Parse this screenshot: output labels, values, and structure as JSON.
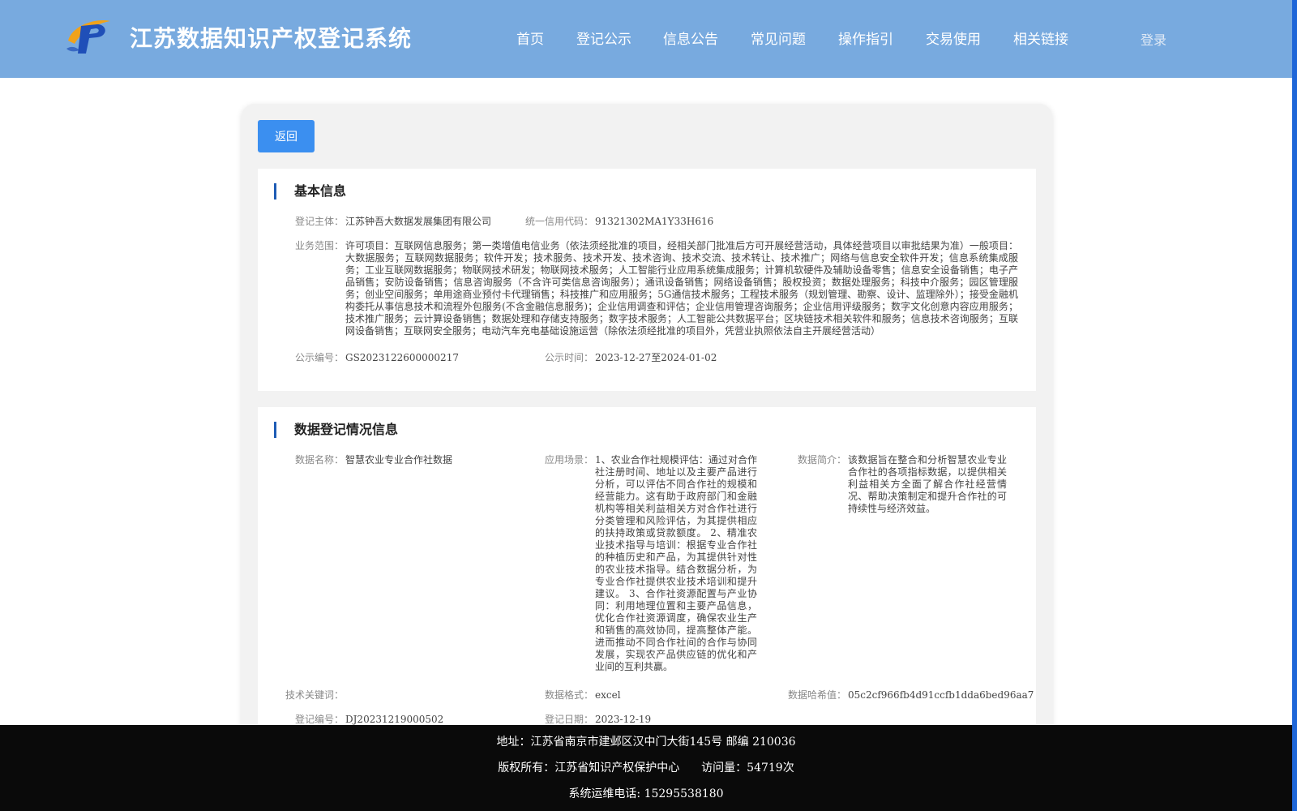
{
  "header": {
    "title": "江苏数据知识产权登记系统",
    "nav": [
      "首页",
      "登记公示",
      "信息公告",
      "常见问题",
      "操作指引",
      "交易使用",
      "相关链接"
    ],
    "login": "登录",
    "logo_colors": [
      "#f0a21a",
      "#1f4fb8"
    ]
  },
  "back_button": "返回",
  "basic": {
    "title": "基本信息",
    "subject_label": "登记主体：",
    "subject": "江苏钟吾大数据发展集团有限公司",
    "credit_label": "统一信用代码：",
    "credit_code": "91321302MA1Y33H616",
    "scope_label": "业务范围：",
    "scope": "许可项目：互联网信息服务；第一类增值电信业务（依法须经批准的项目，经相关部门批准后方可开展经营活动，具体经营项目以审批结果为准）一般项目：大数据服务；互联网数据服务；软件开发；技术服务、技术开发、技术咨询、技术交流、技术转让、技术推广；网络与信息安全软件开发；信息系统集成服务；工业互联网数据服务；物联网技术研发；物联网技术服务；人工智能行业应用系统集成服务；计算机软硬件及辅助设备零售；信息安全设备销售；电子产品销售；安防设备销售；信息咨询服务（不含许可类信息咨询服务）；通讯设备销售；网络设备销售；股权投资；数据处理服务；科技中介服务；园区管理服务；创业空间服务；单用途商业预付卡代理销售；科技推广和应用服务；5G通信技术服务；工程技术服务（规划管理、勘察、设计、监理除外）；接受金融机构委托从事信息技术和流程外包服务(不含金融信息服务)；企业信用调查和评估；企业信用管理咨询服务；企业信用评级服务；数字文化创意内容应用服务；技术推广服务；云计算设备销售；数据处理和存储支持服务；数字技术服务；人工智能公共数据平台；区块链技术相关软件和服务；信息技术咨询服务；互联网设备销售；互联网安全服务；电动汽车充电基础设施运营（除依法须经批准的项目外，凭营业执照依法自主开展经营活动）",
    "pub_no_label": "公示编号：",
    "pub_no": "GS2023122600000217",
    "pub_time_label": "公示时间：",
    "pub_time": "2023-12-27至2024-01-02"
  },
  "registration": {
    "title": "数据登记情况信息",
    "name_label": "数据名称：",
    "name": "智慧农业专业合作社数据",
    "scene_label": "应用场景：",
    "scene": "1、农业合作社规模评估：通过对合作社注册时间、地址以及主要产品进行分析，可以评估不同合作社的规模和经营能力。这有助于政府部门和金融机构等相关利益相关方对合作社进行分类管理和风险评估，为其提供相应的扶持政策或贷款额度。 2、精准农业技术指导与培训：根据专业合作社的种植历史和产品，为其提供针对性的农业技术指导。结合数据分析，为专业合作社提供农业技术培训和提升建议。 3、合作社资源配置与产业协同：利用地理位置和主要产品信息，优化合作社资源调度，确保农业生产和销售的高效协同，提高整体产能。进而推动不同合作社间的合作与协同发展，实现农产品供应链的优化和产业间的互利共赢。",
    "intro_label": "数据简介：",
    "intro": "该数据旨在整合和分析智慧农业专业合作社的各项指标数据，以提供相关利益相关方全面了解合作社经营情况、帮助决策制定和提升合作社的可持续性与经济效益。",
    "keywords_label": "技术关键词：",
    "keywords": "",
    "format_label": "数据格式：",
    "format": "excel",
    "hash_label": "数据哈希值：",
    "hash": "05c2cf966fb4d91ccfb1dda6bed96aa7",
    "reg_no_label": "登记编号：",
    "reg_no": "DJ20231219000502",
    "reg_date_label": "登记日期：",
    "reg_date": "2023-12-19"
  },
  "footer": {
    "address": "地址：江苏省南京市建邺区汉中门大街145号 邮编 210036",
    "copyright": "版权所有：江苏省知识产权保护中心",
    "visits_label": "访问量：",
    "visits": "54719次",
    "phone": "系统运维电话: 15295538180"
  }
}
